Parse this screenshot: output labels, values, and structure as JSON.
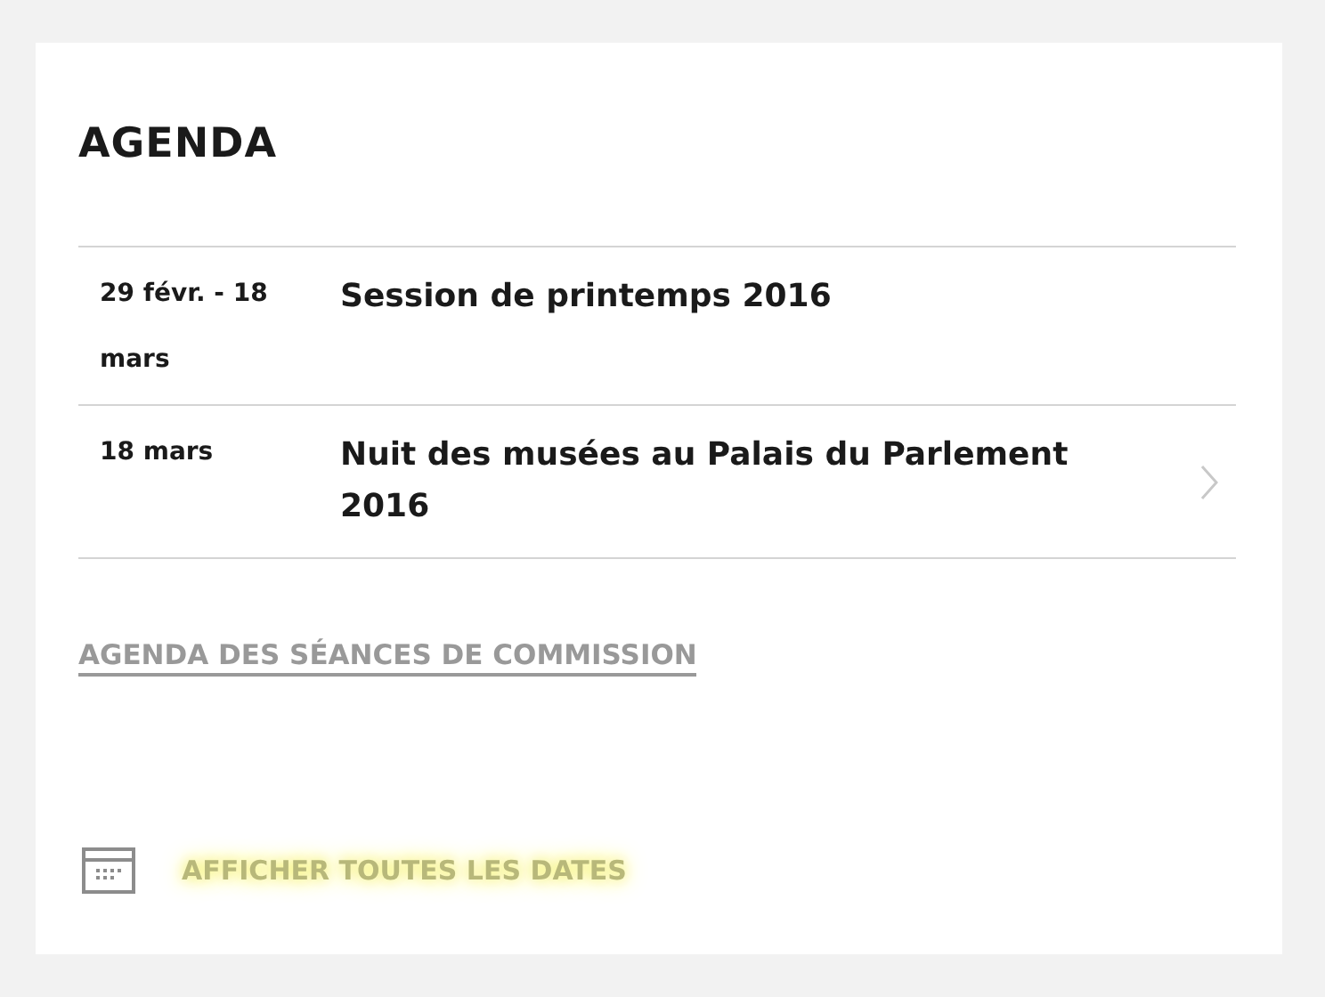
{
  "title": "AGENDA",
  "events": [
    {
      "date": "29 févr. - 18 mars",
      "title": "Session de printemps 2016",
      "arrow": false
    },
    {
      "date": "18 mars",
      "title": "Nuit des musées au Palais du Parlement 2016",
      "arrow": true
    }
  ],
  "commission_link": "AGENDA DES SÉANCES DE COMMISSION",
  "all_dates_link": "AFFICHER TOUTES LES DATES"
}
